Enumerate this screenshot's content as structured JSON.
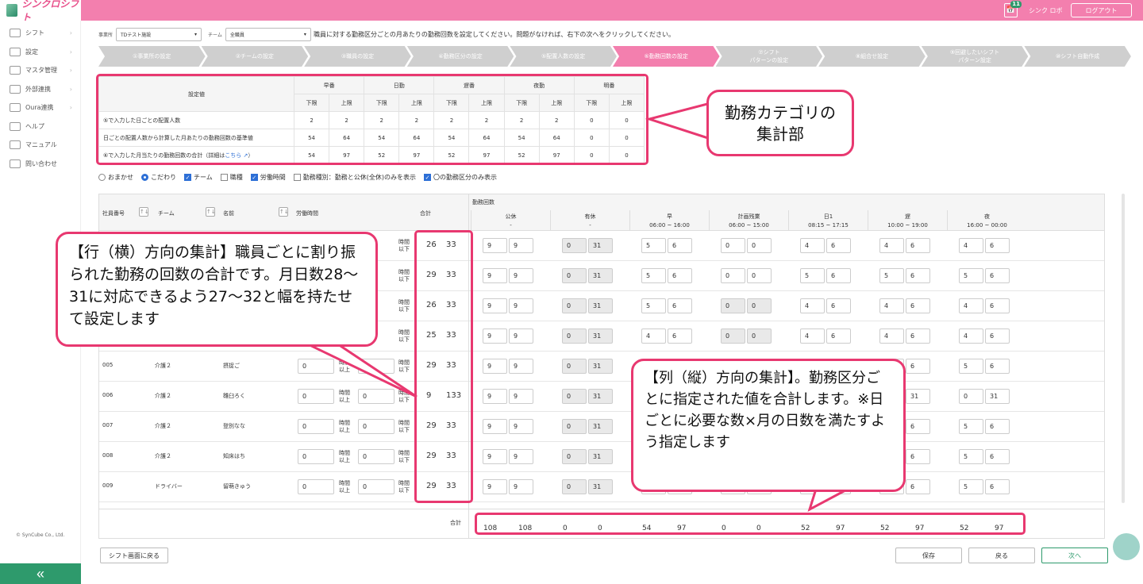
{
  "app": {
    "logo": "シンクロシフト",
    "notif_count": "11",
    "user": "シンク ロボ",
    "logout": "ログアウト",
    "copyright": "© SynCube Co., Ltd.",
    "collapse": "«"
  },
  "sidebar": [
    {
      "label": "シフト",
      "arrow": "›"
    },
    {
      "label": "設定",
      "arrow": "›"
    },
    {
      "label": "マスタ管理",
      "arrow": "›"
    },
    {
      "label": "外部連携",
      "arrow": "›"
    },
    {
      "label": "Oura連携",
      "arrow": "›"
    },
    {
      "label": "ヘルプ",
      "arrow": ""
    },
    {
      "label": "マニュアル",
      "arrow": ""
    },
    {
      "label": "問い合わせ",
      "arrow": ""
    }
  ],
  "filters": {
    "office_label": "事業所",
    "office_value": "TDテスト施設",
    "team_label": "チーム",
    "team_value": "全職員"
  },
  "instruction": "職員に対する勤務区分ごとの月あたりの勤務回数を設定してください。問題がなければ、右下の次へをクリックしてください。",
  "steps": [
    "①事業所の設定",
    "②チームの設定",
    "③職員の設定",
    "④勤務区分の設定",
    "⑤配置人数の設定",
    "⑥勤務回数の設定",
    "⑦シフト\nパターンの設定",
    "⑧組合せ設定",
    "⑨回避したいシフト\nパターン設定",
    "⑩シフト自動作成"
  ],
  "summary": {
    "corner": "設定値",
    "categories": [
      "早番",
      "日勤",
      "遅番",
      "夜勤",
      "明番"
    ],
    "lower": "下限",
    "upper": "上限",
    "rows": [
      {
        "label": "⑤で入力した日ごとの配置人数",
        "values": [
          "2",
          "2",
          "2",
          "2",
          "2",
          "2",
          "2",
          "2",
          "0",
          "0"
        ]
      },
      {
        "label": "日ごとの配置人数から計算した月あたりの勤務回数の基準値",
        "values": [
          "54",
          "64",
          "54",
          "64",
          "54",
          "64",
          "54",
          "64",
          "0",
          "0"
        ]
      },
      {
        "label": "⑥で入力した月当たりの勤務回数の合計（詳細は",
        "link": "こちら",
        "suffix": "）",
        "values": [
          "54",
          "97",
          "52",
          "97",
          "52",
          "97",
          "52",
          "97",
          "0",
          "0"
        ]
      }
    ]
  },
  "options": [
    {
      "type": "radio",
      "label": "おまかせ",
      "on": false
    },
    {
      "type": "radio",
      "label": "こだわり",
      "on": true
    },
    {
      "type": "check",
      "label": "チーム",
      "on": true
    },
    {
      "type": "check",
      "label": "職種",
      "on": false
    },
    {
      "type": "check",
      "label": "労働時間",
      "on": true
    },
    {
      "type": "check",
      "label": "勤務種別：勤務と公休(全休)のみを表示",
      "on": false
    },
    {
      "type": "check",
      "label": "〇の勤務区分のみ表示",
      "on": true
    }
  ],
  "grid": {
    "h_emp": "社員番号",
    "h_team": "チーム",
    "h_name": "名前",
    "h_hours": "労働時間",
    "h_total": "合計",
    "h_counts": "勤務回数",
    "sort_icon": "↑↓",
    "categories": [
      {
        "name": "公休",
        "time": "-"
      },
      {
        "name": "有休",
        "time": "-"
      },
      {
        "name": "早",
        "time": "06:00 ~ 16:00"
      },
      {
        "name": "計画残業",
        "time": "06:00 ~ 15:00"
      },
      {
        "name": "日1",
        "time": "08:15 ~ 17:15"
      },
      {
        "name": "遅",
        "time": "10:00 ~ 19:00"
      },
      {
        "name": "夜",
        "time": "16:00 ~ 00:00"
      }
    ],
    "unit_over": "時間\n以上",
    "unit_under": "時間\n以下",
    "rows": [
      {
        "emp": "",
        "team": "",
        "name": "",
        "h1": "",
        "h2": "",
        "tmin": "26",
        "tmax": "33",
        "c": [
          [
            "9",
            "9"
          ],
          [
            "0",
            "31"
          ],
          [
            "5",
            "6"
          ],
          [
            "0",
            "0"
          ],
          [
            "4",
            "6"
          ],
          [
            "4",
            "6"
          ],
          [
            "4",
            "6"
          ]
        ]
      },
      {
        "emp": "",
        "team": "",
        "name": "",
        "h1": "",
        "h2": "",
        "tmin": "29",
        "tmax": "33",
        "c": [
          [
            "9",
            "9"
          ],
          [
            "0",
            "31"
          ],
          [
            "5",
            "6"
          ],
          [
            "0",
            "0"
          ],
          [
            "5",
            "6"
          ],
          [
            "5",
            "6"
          ],
          [
            "5",
            "6"
          ]
        ]
      },
      {
        "emp": "",
        "team": "",
        "name": "",
        "h1": "",
        "h2": "",
        "tmin": "26",
        "tmax": "33",
        "c": [
          [
            "9",
            "9"
          ],
          [
            "0",
            "31"
          ],
          [
            "5",
            "6"
          ],
          [
            "0",
            "0"
          ],
          [
            "4",
            "6"
          ],
          [
            "4",
            "6"
          ],
          [
            "4",
            "6"
          ]
        ]
      },
      {
        "emp": "",
        "team": "",
        "name": "",
        "h1": "",
        "h2": "",
        "tmin": "25",
        "tmax": "33",
        "c": [
          [
            "9",
            "9"
          ],
          [
            "0",
            "31"
          ],
          [
            "4",
            "6"
          ],
          [
            "0",
            "0"
          ],
          [
            "4",
            "6"
          ],
          [
            "4",
            "6"
          ],
          [
            "4",
            "6"
          ]
        ]
      },
      {
        "emp": "005",
        "team": "介護２",
        "name": "摂捉ご",
        "h1": "0",
        "h2": "0",
        "tmin": "29",
        "tmax": "33",
        "c": [
          [
            "9",
            "9"
          ],
          [
            "0",
            "31"
          ],
          [
            "5",
            "6"
          ],
          [
            "0",
            "0"
          ],
          [
            "5",
            "6"
          ],
          [
            "5",
            "6"
          ],
          [
            "5",
            "6"
          ]
        ]
      },
      {
        "emp": "006",
        "team": "介護２",
        "name": "雛臼ろく",
        "h1": "0",
        "h2": "0",
        "tmin": "9",
        "tmax": "133",
        "c": [
          [
            "9",
            "9"
          ],
          [
            "0",
            "31"
          ],
          [
            "0",
            "31"
          ],
          [
            "0",
            "31"
          ],
          [
            "0",
            "31"
          ],
          [
            "0",
            "31"
          ],
          [
            "0",
            "31"
          ]
        ]
      },
      {
        "emp": "007",
        "team": "介護２",
        "name": "登別なな",
        "h1": "0",
        "h2": "0",
        "tmin": "29",
        "tmax": "33",
        "c": [
          [
            "9",
            "9"
          ],
          [
            "0",
            "31"
          ],
          [
            "5",
            "6"
          ],
          [
            "0",
            "0"
          ],
          [
            "5",
            "6"
          ],
          [
            "5",
            "6"
          ],
          [
            "5",
            "6"
          ]
        ]
      },
      {
        "emp": "008",
        "team": "介護２",
        "name": "知床はち",
        "h1": "0",
        "h2": "0",
        "tmin": "29",
        "tmax": "33",
        "c": [
          [
            "9",
            "9"
          ],
          [
            "0",
            "31"
          ],
          [
            "5",
            "6"
          ],
          [
            "0",
            "0"
          ],
          [
            "5",
            "6"
          ],
          [
            "5",
            "6"
          ],
          [
            "5",
            "6"
          ]
        ]
      },
      {
        "emp": "009",
        "team": "ドライバー",
        "name": "留萌きゅう",
        "h1": "0",
        "h2": "0",
        "tmin": "29",
        "tmax": "33",
        "c": [
          [
            "9",
            "9"
          ],
          [
            "0",
            "31"
          ],
          [
            "5",
            "6"
          ],
          [
            "0",
            "0"
          ],
          [
            "5",
            "6"
          ],
          [
            "5",
            "6"
          ],
          [
            "5",
            "6"
          ]
        ]
      }
    ],
    "totals_label": "合計",
    "totals": [
      "108",
      "108",
      "0",
      "0",
      "54",
      "97",
      "0",
      "0",
      "52",
      "97",
      "52",
      "97",
      "52",
      "97"
    ]
  },
  "bubbles": {
    "b1": "勤務カテゴリの\n集計部",
    "b2": "【行（横）方向の集計】職員ごとに割り振られた勤務の回数の合計です。月日数28〜31に対応できるよう27〜32と幅を持たせて設定します",
    "b3": "【列（縦）方向の集計】。勤務区分ごとに指定された値を合計します。※日ごとに必要な数×月の日数を満たすよう指定します"
  },
  "buttons": {
    "back_to_shift": "シフト画面に戻る",
    "save": "保存",
    "back": "戻る",
    "next": "次へ"
  }
}
